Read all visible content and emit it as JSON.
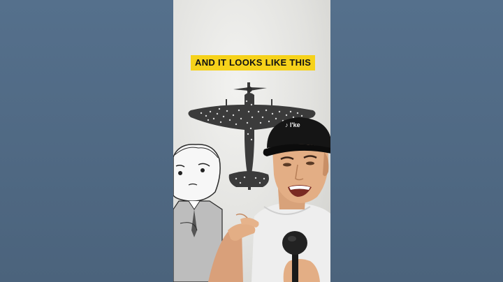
{
  "caption": {
    "text": "AND IT LOOKS LIKE THIS"
  },
  "cap_text": "♪ I'ke",
  "colors": {
    "background": "#4f6780",
    "caption_bg": "#f6d21a",
    "aircraft": "#3b3b3b",
    "bullet_holes": "#d8d8d8"
  },
  "icons": {
    "aircraft": "aircraft-silhouette-icon",
    "cartoon": "cartoon-character",
    "person": "presenter-person",
    "microphone": "microphone-icon"
  }
}
